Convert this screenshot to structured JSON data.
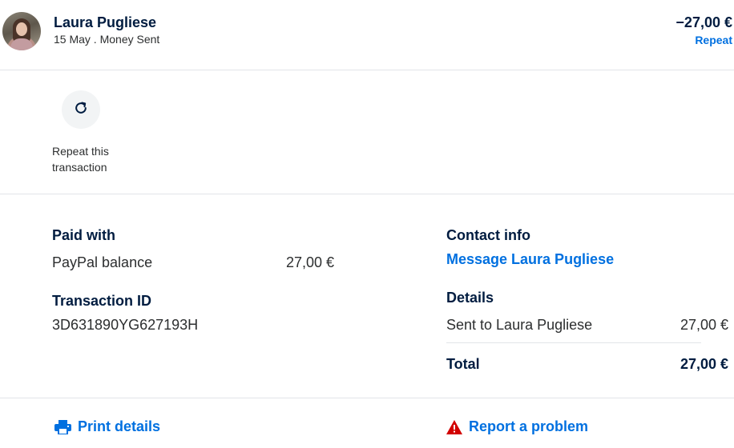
{
  "header": {
    "name": "Laura Pugliese",
    "subtitle": "15 May . Money Sent",
    "amount": "−27,00 €",
    "repeat_link": "Repeat"
  },
  "actions": {
    "repeat_label": "Repeat this transaction",
    "repeat_icon": "refresh-icon"
  },
  "paid_with": {
    "heading": "Paid with",
    "method": "PayPal balance",
    "amount": "27,00 €"
  },
  "transaction": {
    "heading": "Transaction ID",
    "id": "3D631890YG627193H"
  },
  "contact": {
    "heading": "Contact info",
    "message_link": "Message Laura Pugliese"
  },
  "details": {
    "heading": "Details",
    "sent_to_label": "Sent to Laura Pugliese",
    "sent_to_amount": "27,00 €",
    "total_label": "Total",
    "total_amount": "27,00 €"
  },
  "footer": {
    "print_label": "Print details",
    "report_label": "Report a problem"
  },
  "colors": {
    "accent": "#0070e0",
    "text_dark": "#001c40",
    "warning": "#d20000"
  }
}
